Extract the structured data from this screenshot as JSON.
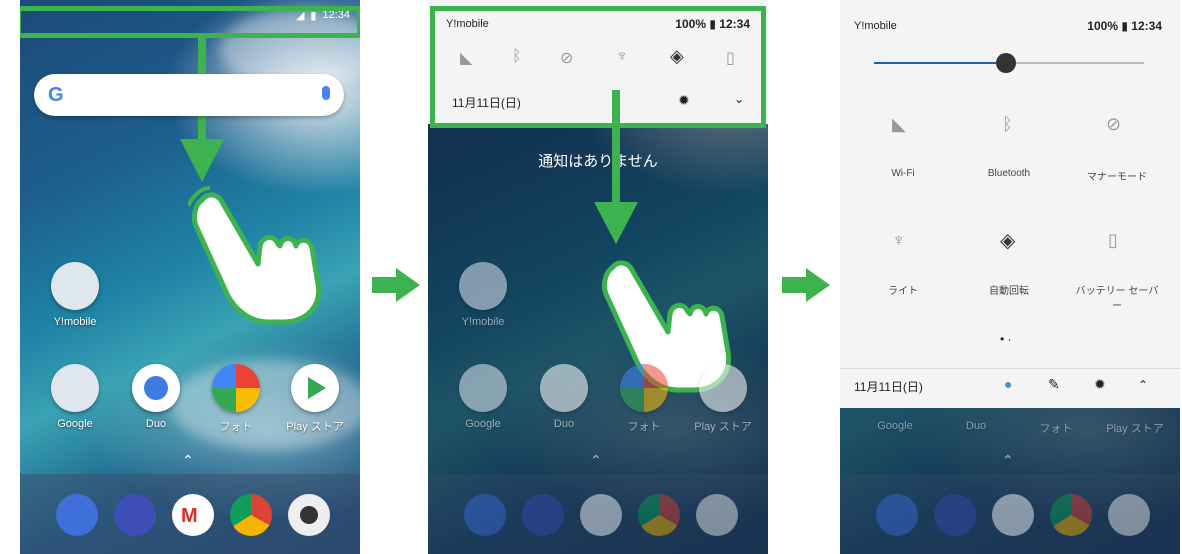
{
  "colors": {
    "accent": "#3db350",
    "wallpaper": "#1d5e8c",
    "shade": "#f4f4f4"
  },
  "screen1": {
    "status": {
      "time": "12:34"
    },
    "search": {
      "logo": "G",
      "icon": "mic-icon"
    },
    "apps": [
      {
        "label": "Y!mobile"
      },
      {
        "label": "Google"
      },
      {
        "label": "Duo"
      },
      {
        "label": "フォト"
      },
      {
        "label": "Play ストア"
      }
    ]
  },
  "screen2": {
    "status": {
      "carrier": "Y!mobile",
      "battery": "100%",
      "time": "12:34"
    },
    "date": "11月11日(日)",
    "notice": "通知はありません",
    "apps": [
      {
        "label": "Y!mobile"
      },
      {
        "label": "Google"
      },
      {
        "label": "Duo"
      },
      {
        "label": "フォト"
      },
      {
        "label": "Play ストア"
      }
    ]
  },
  "screen3": {
    "status": {
      "carrier": "Y!mobile",
      "battery": "100%",
      "time": "12:34"
    },
    "tiles": [
      {
        "label": "Wi-Fi",
        "icon": "wifi-icon"
      },
      {
        "label": "Bluetooth",
        "icon": "bluetooth-icon"
      },
      {
        "label": "マナーモード",
        "icon": "dnd-icon"
      },
      {
        "label": "ライト",
        "icon": "flashlight-icon"
      },
      {
        "label": "自動回転",
        "icon": "rotate-icon"
      },
      {
        "label": "バッテリー セーバー",
        "icon": "battery-icon"
      }
    ],
    "date": "11月11日(日)",
    "apps": [
      {
        "label": "Google"
      },
      {
        "label": "Duo"
      },
      {
        "label": "フォト"
      },
      {
        "label": "Play ストア"
      }
    ]
  }
}
